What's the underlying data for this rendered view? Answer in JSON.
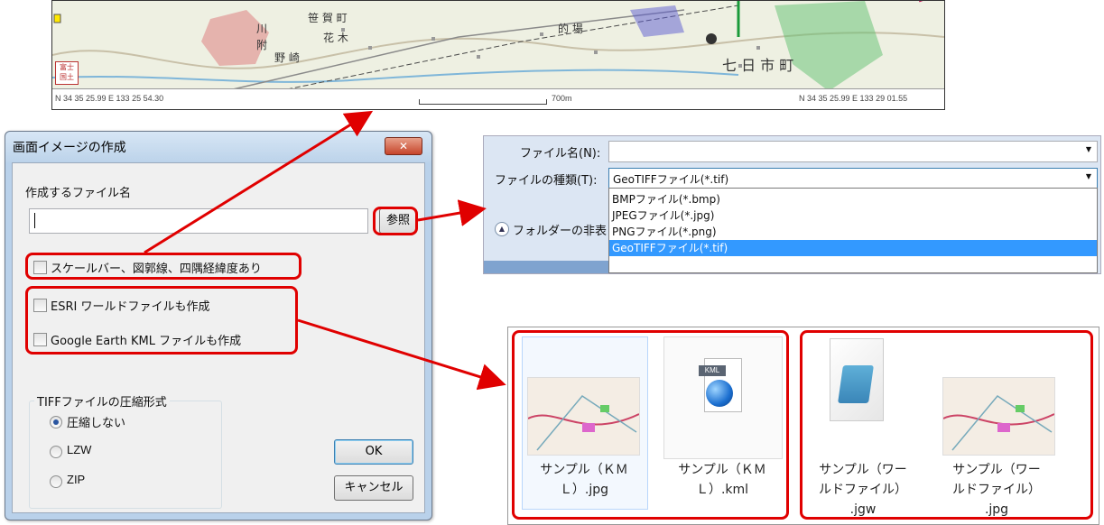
{
  "map": {
    "place_labels": [
      "笹 賀 町",
      "花 木",
      "野 崎",
      "川",
      "附",
      "七 日 市 町",
      "的 場"
    ],
    "coord_left": "N 34 35 25.99  E 133 25 54.30",
    "scale_label": "700m",
    "coord_right": "N 34 35 25.99  E 133 29 01.55",
    "stamp": "富士\n国土"
  },
  "dialog": {
    "title": "画面イメージの作成",
    "close_label": "✕",
    "filename_label": "作成するファイル名",
    "filename_value": "",
    "browse_label": "参照",
    "check_scalebar": "スケールバー、図郭線、四隅経緯度あり",
    "check_esri": "ESRI ワールドファイルも作成",
    "check_kml": "Google Earth KML ファイルも作成",
    "compression_group": "TIFFファイルの圧縮形式",
    "compression_options": [
      "圧縮しない",
      "LZW",
      "ZIP"
    ],
    "compression_selected": "圧縮しない",
    "ok_label": "OK",
    "cancel_label": "キャンセル"
  },
  "save_dialog": {
    "filename_label": "ファイル名(N):",
    "filetype_label": "ファイルの種類(T):",
    "filetype_value": "GeoTIFFファイル(*.tif)",
    "folder_toggle": "フォルダーの非表",
    "filetype_options": [
      "BMPファイル(*.bmp)",
      "JPEGファイル(*.jpg)",
      "PNGファイル(*.png)",
      "GeoTIFFファイル(*.tif)"
    ],
    "selected_index": 3
  },
  "files": [
    {
      "name_line1": "サンプル（ＫＭ",
      "name_line2": "Ｌ）.jpg",
      "icon": "map-thumbnail-icon"
    },
    {
      "name_line1": "サンプル（ＫＭ",
      "name_line2": "Ｌ）.kml",
      "icon": "kml-file-icon"
    },
    {
      "name_line1": "サンプル（ワー",
      "name_line2": "ルドファイル）",
      "name_line3": ".jgw",
      "icon": "notepad-icon"
    },
    {
      "name_line1": "サンプル（ワー",
      "name_line2": "ルドファイル）",
      "name_line3": ".jpg",
      "icon": "map-thumbnail-icon"
    }
  ],
  "kml_badge": "KML",
  "colors": {
    "highlight": "#e00000",
    "selection": "#3399ff",
    "dialog_frame": "#b9d1ea"
  }
}
